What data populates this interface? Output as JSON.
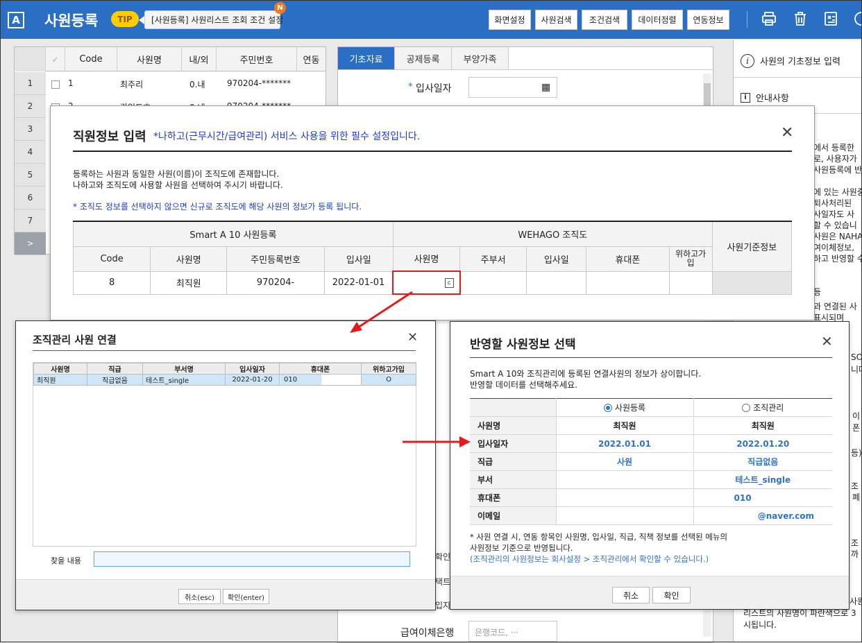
{
  "topbar": {
    "app_icon": "A",
    "title": "사원등록",
    "tip_badge": "TIP",
    "tip_text": "[사원등록] 사원리스트 조회 조건 설정",
    "tip_new": "N",
    "buttons": [
      "화면설정",
      "사원검색",
      "조건검색",
      "데이터정렬",
      "연동정보"
    ],
    "icons": [
      "print-icon",
      "trash-icon",
      "excel-icon",
      "more-icon"
    ]
  },
  "left_table": {
    "headers": [
      "✓",
      "Code",
      "사원명",
      "내/외",
      "주민번호",
      "연동"
    ],
    "rows": [
      {
        "num": "1",
        "code": "1",
        "name": "최주리",
        "type": "0.내",
        "id": "970204-*******"
      },
      {
        "num": "2",
        "code": "2",
        "name": "강임도호",
        "type": "0.내",
        "id": "970204-*******"
      }
    ],
    "row_numbers": [
      "3",
      "4",
      "5",
      "6",
      "7",
      ">"
    ]
  },
  "middle": {
    "tabs": [
      "기초자료",
      "공제등록",
      "부양가족"
    ],
    "hire_label": "입사일자",
    "required_mark": "*",
    "bank_label": "급여이체은행",
    "bank_placeholder": "은행코드, ···",
    "confirm_frag": "확인",
    "frag1": "입지",
    "frag2": "택트"
  },
  "right_panel": {
    "item1": "사원의 기초정보 입력",
    "item2": "안내사항",
    "frags": [
      "에서 등록한",
      "로, 사용자가",
      "사원등록에 반",
      "에 있는 사원중",
      "퇴사처리된",
      "사일자도 사",
      "할 수 있습니",
      "사원은 NAHAG",
      "여이체정보,",
      "하고 반영할 수",
      "등",
      "과 연결된 사",
      "표시되며",
      "SO.",
      "니다",
      "이",
      "폰",
      "등)",
      "조",
      "폐",
      "조",
      "까",
      "사원",
      "리스트의 사원명이 파란색으로 3",
      "시됩니다."
    ]
  },
  "dialog_main": {
    "title": "직원정보 입력",
    "subtitle": "*나하고(근무시간/급여관리) 서비스 사용을 위한 필수 설정입니다.",
    "desc1": "등록하는 사원과 동일한 사원(이름)이 조직도에 존재합니다.",
    "desc2": "나하고와 조직도에 사용할 사원을 선택하여 주시기 바랍니다.",
    "note": "* 조직도 정보를 선택하지 않으면 신규로 조직도에 해당 사원의 정보가 등록 됩니다.",
    "group1": "Smart A 10 사원등록",
    "group2": "WEHAGO 조직도",
    "group3": "사원기준정보",
    "cols": [
      "Code",
      "사원명",
      "주민등록번호",
      "입사일",
      "사원명",
      "주부서",
      "입사일",
      "휴대폰",
      "위하고가입"
    ],
    "row": {
      "code": "8",
      "name": "최직원",
      "id": "970204-",
      "hire": "2022-01-01"
    },
    "lookup_icon": "c"
  },
  "dialog_org": {
    "title": "조직관리 사원 연결",
    "cols": [
      "사원명",
      "직급",
      "부서명",
      "입사일자",
      "휴대폰",
      "위하고가입"
    ],
    "row": {
      "name": "최직원",
      "rank": "직급없음",
      "dept": "테스트_single",
      "hire": "2022-01-20",
      "phone": "010",
      "joined": "O"
    },
    "search_label": "찾을 내용",
    "cancel": "취소(esc)",
    "ok": "확인(enter)"
  },
  "dialog_select": {
    "title": "반영할 사원정보 선택",
    "desc1": "Smart A 10와 조직관리에 등록된 연결사원의 정보가 상이합니다.",
    "desc2": "반영할 데이터를 선택해주세요.",
    "option1": "사원등록",
    "option2": "조직관리",
    "rows": [
      {
        "label": "사원명",
        "a": "최직원",
        "b": "최직원"
      },
      {
        "label": "입사일자",
        "a": "2022.01.01",
        "b": "2022.01.20"
      },
      {
        "label": "직급",
        "a": "사원",
        "b": "직급없음"
      },
      {
        "label": "부서",
        "a": "",
        "b": "테스트_single"
      },
      {
        "label": "휴대폰",
        "a": "",
        "b": "010"
      },
      {
        "label": "이메일",
        "a": "",
        "b": "@naver.com"
      }
    ],
    "note1": "* 사원 연결 시, 연동 항목인 사원명, 입사일, 직급, 직책 정보를 선택된 메뉴의",
    "note2": "사원정보 기준으로 반영됩니다.",
    "note3": "(조직관리의 사원정보는 회사설정 > 조직관리에서 확인할 수 있습니다.)",
    "cancel": "취소",
    "ok": "확인"
  },
  "colors": {
    "topbar": "#2b6fc4",
    "accent_blue": "#2f73c7",
    "highlight_red": "#e31b1b",
    "tip_yellow": "#ffcc00"
  }
}
